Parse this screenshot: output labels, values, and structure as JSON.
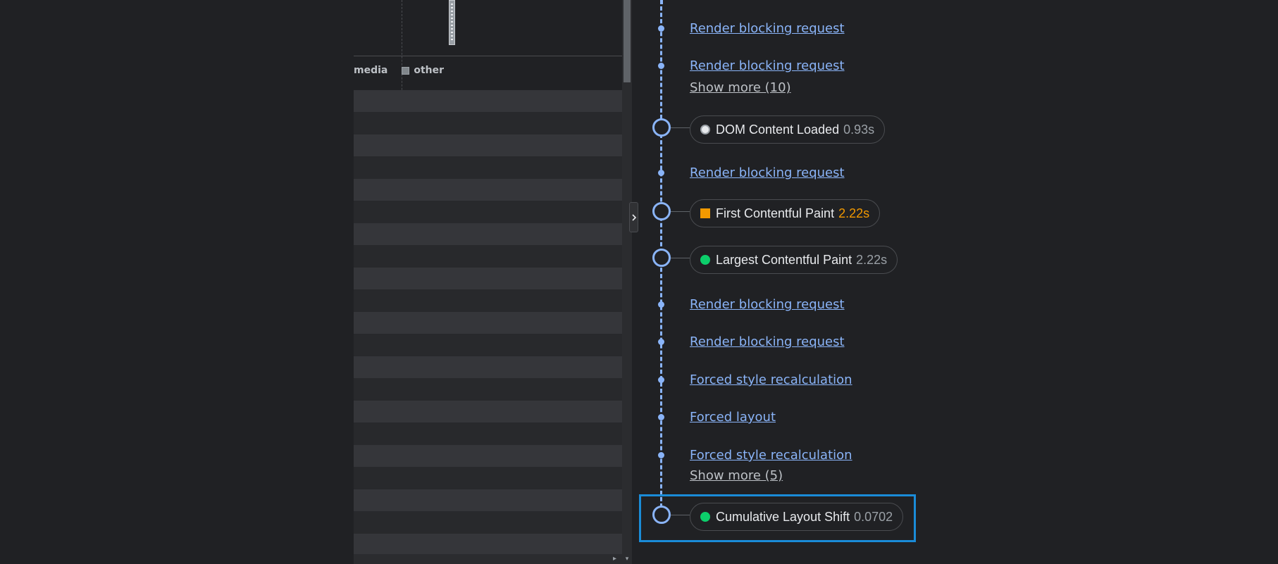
{
  "network_panel": {
    "legend": [
      {
        "label": "media",
        "swatch": false
      },
      {
        "label": "other",
        "swatch": true
      }
    ]
  },
  "insights": {
    "items": [
      {
        "kind": "link",
        "label": "Render blocking request"
      },
      {
        "kind": "link",
        "label": "Render blocking request"
      },
      {
        "kind": "show_more",
        "label": "Show more (10)"
      },
      {
        "kind": "milestone",
        "label": "DOM Content Loaded",
        "value": "0.93s",
        "icon": "white-circle-icon"
      },
      {
        "kind": "link",
        "label": "Render blocking request"
      },
      {
        "kind": "milestone",
        "label": "First Contentful Paint",
        "value": "2.22s",
        "icon": "orange-square-icon",
        "value_color": "#f29900"
      },
      {
        "kind": "milestone",
        "label": "Largest Contentful Paint",
        "value": "2.22s",
        "icon": "green-circle-icon"
      },
      {
        "kind": "link",
        "label": "Render blocking request"
      },
      {
        "kind": "link",
        "label": "Render blocking request"
      },
      {
        "kind": "link",
        "label": "Forced style recalculation"
      },
      {
        "kind": "link",
        "label": "Forced layout"
      },
      {
        "kind": "link",
        "label": "Forced style recalculation"
      },
      {
        "kind": "show_more",
        "label": "Show more (5)"
      },
      {
        "kind": "milestone",
        "label": "Cumulative Layout Shift",
        "value": "0.0702",
        "icon": "green-circle-icon",
        "highlighted": true
      }
    ]
  },
  "colors": {
    "accent": "#8ab4f8",
    "highlight_border": "#1a8cd8",
    "good": "#0cce6b",
    "average": "#f29900",
    "background": "#202124"
  }
}
